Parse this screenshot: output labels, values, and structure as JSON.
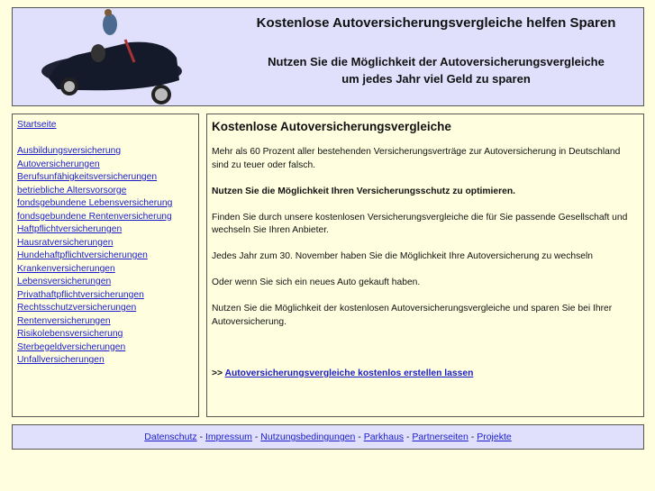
{
  "header": {
    "title": "Kostenlose Autoversicherungsvergleiche helfen Sparen",
    "subtitle_line1": "Nutzen Sie die Möglichkeit der Autoversicherungsvergleiche",
    "subtitle_line2": "um jedes Jahr viel Geld zu sparen"
  },
  "sidebar": {
    "start": "Startseite",
    "items": [
      "Ausbildungsversicherung",
      "Autoversicherungen",
      "Berufsunfähigkeitsversicherungen",
      "betriebliche Altersvorsorge",
      "fondsgebundene Lebensversicherung",
      "fondsgebundene Rentenversicherung",
      "Haftpflichtversicherungen",
      "Hausratversicherungen",
      "Hundehaftpflichtversicherungen",
      "Krankenversicherungen",
      "Lebensversicherungen",
      "Privathaftpflichtversicherungen",
      "Rechtsschutzversicherungen",
      "Rentenversicherungen",
      "Risikolebensversicherung",
      "Sterbegeldversicherungen",
      "Unfallversicherungen"
    ]
  },
  "main": {
    "heading": "Kostenlose Autoversicherungsvergleiche",
    "p1": "Mehr als 60 Prozent aller bestehenden Versicherungsverträge zur Autoversicherung in Deutschland sind zu teuer oder falsch.",
    "p2": "Nutzen Sie die Möglichkeit Ihren Versicherungsschutz zu optimieren.",
    "p3": "Finden Sie durch unsere kostenlosen Versicherungsvergleiche die für Sie passende Gesellschaft und wechseln Sie Ihren Anbieter.",
    "p4": "Jedes Jahr zum 30. November haben Sie die Möglichkeit Ihre Autoversicherung zu wechseln",
    "p5": "Oder wenn Sie sich ein neues Auto gekauft haben.",
    "p6": "Nutzen Sie die Möglichkeit der kostenlosen Autoversicherungsvergleiche und sparen Sie bei Ihrer Autoversicherung.",
    "cta_prefix": ">>",
    "cta_link": "Autoversicherungsvergleiche kostenlos erstellen lassen"
  },
  "footer": {
    "links": [
      "Datenschutz",
      "Impressum",
      "Nutzungsbedingungen",
      "Parkhaus",
      "Partnerseiten",
      "Projekte"
    ],
    "separator": " - "
  }
}
